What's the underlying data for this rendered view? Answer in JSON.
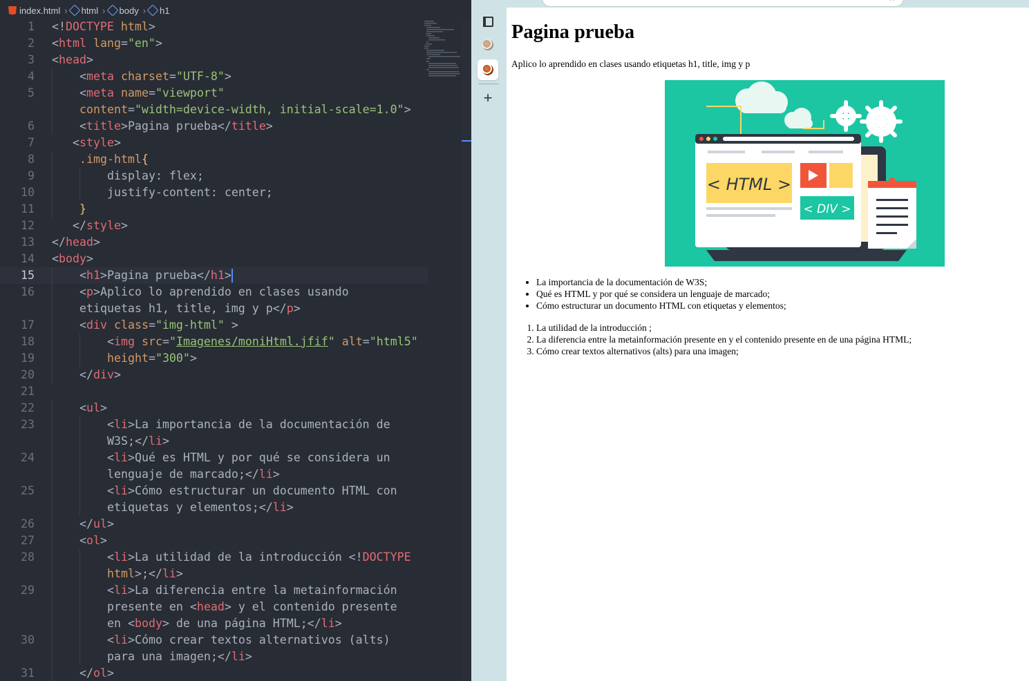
{
  "editor": {
    "breadcrumb": [
      "index.html",
      "html",
      "body",
      "h1"
    ],
    "current_line": 15,
    "lines": [
      {
        "n": "1",
        "i": 0,
        "t": [
          [
            "p",
            "<!"
          ],
          [
            "t",
            "DOCTYPE"
          ],
          [
            "p",
            " "
          ],
          [
            "a",
            "html"
          ],
          [
            "p",
            ">"
          ]
        ]
      },
      {
        "n": "2",
        "i": 0,
        "t": [
          [
            "p",
            "<"
          ],
          [
            "t",
            "html"
          ],
          [
            "p",
            " "
          ],
          [
            "a",
            "lang"
          ],
          [
            "p",
            "="
          ],
          [
            "s",
            "\"en\""
          ],
          [
            "p",
            ">"
          ]
        ]
      },
      {
        "n": "3",
        "i": 0,
        "t": [
          [
            "p",
            "<"
          ],
          [
            "t",
            "head"
          ],
          [
            "p",
            ">"
          ]
        ]
      },
      {
        "n": "4",
        "i": 2,
        "t": [
          [
            "p",
            "<"
          ],
          [
            "t",
            "meta"
          ],
          [
            "p",
            " "
          ],
          [
            "a",
            "charset"
          ],
          [
            "p",
            "="
          ],
          [
            "s",
            "\"UTF-8\""
          ],
          [
            "p",
            ">"
          ]
        ]
      },
      {
        "n": "5",
        "i": 2,
        "t": [
          [
            "p",
            "<"
          ],
          [
            "t",
            "meta"
          ],
          [
            "p",
            " "
          ],
          [
            "a",
            "name"
          ],
          [
            "p",
            "="
          ],
          [
            "s",
            "\"viewport\""
          ]
        ]
      },
      {
        "n": "",
        "i": 2,
        "t": [
          [
            "a",
            "content"
          ],
          [
            "p",
            "="
          ],
          [
            "s",
            "\"width=device-width, initial-scale=1.0\""
          ],
          [
            "p",
            ">"
          ]
        ]
      },
      {
        "n": "6",
        "i": 2,
        "t": [
          [
            "p",
            "<"
          ],
          [
            "t",
            "title"
          ],
          [
            "p",
            ">Pagina prueba</"
          ],
          [
            "t",
            "title"
          ],
          [
            "p",
            ">"
          ]
        ]
      },
      {
        "n": "7",
        "i": 1.5,
        "t": [
          [
            "p",
            "<"
          ],
          [
            "t",
            "style"
          ],
          [
            "p",
            ">"
          ]
        ]
      },
      {
        "n": "8",
        "i": 2,
        "t": [
          [
            "c",
            ".img-html"
          ],
          [
            "b",
            "{"
          ]
        ]
      },
      {
        "n": "9",
        "i": 4,
        "t": [
          [
            "p",
            "display: flex;"
          ]
        ]
      },
      {
        "n": "10",
        "i": 4,
        "t": [
          [
            "p",
            "justify-content: center;"
          ]
        ]
      },
      {
        "n": "11",
        "i": 2,
        "t": [
          [
            "b",
            "}"
          ]
        ]
      },
      {
        "n": "12",
        "i": 1.5,
        "t": [
          [
            "p",
            "</"
          ],
          [
            "t",
            "style"
          ],
          [
            "p",
            ">"
          ]
        ]
      },
      {
        "n": "13",
        "i": 0,
        "t": [
          [
            "p",
            "</"
          ],
          [
            "t",
            "head"
          ],
          [
            "p",
            ">"
          ]
        ]
      },
      {
        "n": "14",
        "i": 0,
        "t": [
          [
            "p",
            "<"
          ],
          [
            "t",
            "body"
          ],
          [
            "p",
            ">"
          ]
        ]
      },
      {
        "n": "15",
        "i": 2,
        "t": [
          [
            "p",
            "<"
          ],
          [
            "t",
            "h1"
          ],
          [
            "p",
            ">Pagina prueba</"
          ],
          [
            "t",
            "h1"
          ],
          [
            "p",
            ">"
          ]
        ]
      },
      {
        "n": "16",
        "i": 2,
        "t": [
          [
            "p",
            "<"
          ],
          [
            "t",
            "p"
          ],
          [
            "p",
            ">Aplico lo aprendido en clases usando"
          ]
        ]
      },
      {
        "n": "",
        "i": 2,
        "t": [
          [
            "p",
            "etiquetas h1, title, img y p</"
          ],
          [
            "t",
            "p"
          ],
          [
            "p",
            ">"
          ]
        ]
      },
      {
        "n": "17",
        "i": 2,
        "t": [
          [
            "p",
            "<"
          ],
          [
            "t",
            "div"
          ],
          [
            "p",
            " "
          ],
          [
            "a",
            "class"
          ],
          [
            "p",
            "="
          ],
          [
            "s",
            "\"img-html\""
          ],
          [
            "p",
            " >"
          ]
        ]
      },
      {
        "n": "18",
        "i": 4,
        "t": [
          [
            "p",
            "<"
          ],
          [
            "t",
            "img"
          ],
          [
            "p",
            " "
          ],
          [
            "a",
            "src"
          ],
          [
            "p",
            "="
          ],
          [
            "s",
            "\""
          ],
          [
            "u",
            "Imagenes/moniHtml.jfif"
          ],
          [
            "s",
            "\""
          ],
          [
            "p",
            " "
          ],
          [
            "a",
            "alt"
          ],
          [
            "p",
            "="
          ],
          [
            "s",
            "\"html5\""
          ]
        ]
      },
      {
        "n": "19",
        "i": 4,
        "t": [
          [
            "a",
            "height"
          ],
          [
            "p",
            "="
          ],
          [
            "s",
            "\"300\""
          ],
          [
            "p",
            ">"
          ]
        ]
      },
      {
        "n": "20",
        "i": 2,
        "t": [
          [
            "p",
            "</"
          ],
          [
            "t",
            "div"
          ],
          [
            "p",
            ">"
          ]
        ]
      },
      {
        "n": "21",
        "i": 0,
        "t": []
      },
      {
        "n": "22",
        "i": 2,
        "t": [
          [
            "p",
            "<"
          ],
          [
            "t",
            "ul"
          ],
          [
            "p",
            ">"
          ]
        ]
      },
      {
        "n": "23",
        "i": 4,
        "t": [
          [
            "p",
            "<"
          ],
          [
            "t",
            "li"
          ],
          [
            "p",
            ">La importancia de la documentación de"
          ]
        ]
      },
      {
        "n": "",
        "i": 4,
        "t": [
          [
            "p",
            "W3S;</"
          ],
          [
            "t",
            "li"
          ],
          [
            "p",
            ">"
          ]
        ]
      },
      {
        "n": "24",
        "i": 4,
        "t": [
          [
            "p",
            "<"
          ],
          [
            "t",
            "li"
          ],
          [
            "p",
            ">Qué es HTML y por qué se considera un"
          ]
        ]
      },
      {
        "n": "",
        "i": 4,
        "t": [
          [
            "p",
            "lenguaje de marcado;</"
          ],
          [
            "t",
            "li"
          ],
          [
            "p",
            ">"
          ]
        ]
      },
      {
        "n": "25",
        "i": 4,
        "t": [
          [
            "p",
            "<"
          ],
          [
            "t",
            "li"
          ],
          [
            "p",
            ">Cómo estructurar un documento HTML con"
          ]
        ]
      },
      {
        "n": "",
        "i": 4,
        "t": [
          [
            "p",
            "etiquetas y elementos;</"
          ],
          [
            "t",
            "li"
          ],
          [
            "p",
            ">"
          ]
        ]
      },
      {
        "n": "26",
        "i": 2,
        "t": [
          [
            "p",
            "</"
          ],
          [
            "t",
            "ul"
          ],
          [
            "p",
            ">"
          ]
        ]
      },
      {
        "n": "27",
        "i": 2,
        "t": [
          [
            "p",
            "<"
          ],
          [
            "t",
            "ol"
          ],
          [
            "p",
            ">"
          ]
        ]
      },
      {
        "n": "28",
        "i": 4,
        "t": [
          [
            "p",
            "<"
          ],
          [
            "t",
            "li"
          ],
          [
            "p",
            ">La utilidad de la introducción <!"
          ],
          [
            "t",
            "DOCTYPE"
          ]
        ]
      },
      {
        "n": "",
        "i": 4,
        "t": [
          [
            "a",
            "html"
          ],
          [
            "p",
            ">;</"
          ],
          [
            "t",
            "li"
          ],
          [
            "p",
            ">"
          ]
        ]
      },
      {
        "n": "29",
        "i": 4,
        "t": [
          [
            "p",
            "<"
          ],
          [
            "t",
            "li"
          ],
          [
            "p",
            ">La diferencia entre la metainformación"
          ]
        ]
      },
      {
        "n": "",
        "i": 4,
        "t": [
          [
            "p",
            "presente en <"
          ],
          [
            "t",
            "head"
          ],
          [
            "p",
            "> y el contenido presente"
          ]
        ]
      },
      {
        "n": "",
        "i": 4,
        "t": [
          [
            "p",
            "en <"
          ],
          [
            "t",
            "body"
          ],
          [
            "p",
            "> de una página HTML;</"
          ],
          [
            "t",
            "li"
          ],
          [
            "p",
            ">"
          ]
        ]
      },
      {
        "n": "30",
        "i": 4,
        "t": [
          [
            "p",
            "<"
          ],
          [
            "t",
            "li"
          ],
          [
            "p",
            ">Cómo crear textos alternativos (alts)"
          ]
        ]
      },
      {
        "n": "",
        "i": 4,
        "t": [
          [
            "p",
            "para una imagen;</"
          ],
          [
            "t",
            "li"
          ],
          [
            "p",
            ">"
          ]
        ]
      },
      {
        "n": "31",
        "i": 2,
        "t": [
          [
            "p",
            "</"
          ],
          [
            "t",
            "ol"
          ],
          [
            "p",
            ">"
          ]
        ]
      }
    ]
  },
  "browser": {
    "page": {
      "heading": "Pagina prueba",
      "intro": "Aplico lo aprendido en clases usando etiquetas h1, title, img y p",
      "image": {
        "alt": "html5",
        "labels": {
          "html": "< HTML >",
          "div": "< DIV >"
        },
        "colors": {
          "bg": "#1cc6a3",
          "window": "#ffffff",
          "yellow": "#fdd765",
          "orange": "#f0553a",
          "teal": "#1cc6a3",
          "dark": "#2f3742"
        }
      },
      "ul_items": [
        "La importancia de la documentación de W3S;",
        "Qué es HTML y por qué se considera un lenguaje de marcado;",
        "Cómo estructurar un documento HTML con etiquetas y elementos;"
      ],
      "ol_items": [
        "La utilidad de la introducción ;",
        "La diferencia entre la metainformación presente en y el contenido presente en de una página HTML;",
        "Cómo crear textos alternativos (alts) para una imagen;"
      ]
    },
    "icons": [
      "tab-actions-icon",
      "favicon",
      "favicon",
      "new-tab-icon"
    ]
  },
  "colors": {
    "editor_bg": "#282c34",
    "browser_chrome": "#cfe3e6",
    "accent": "#528bff"
  }
}
